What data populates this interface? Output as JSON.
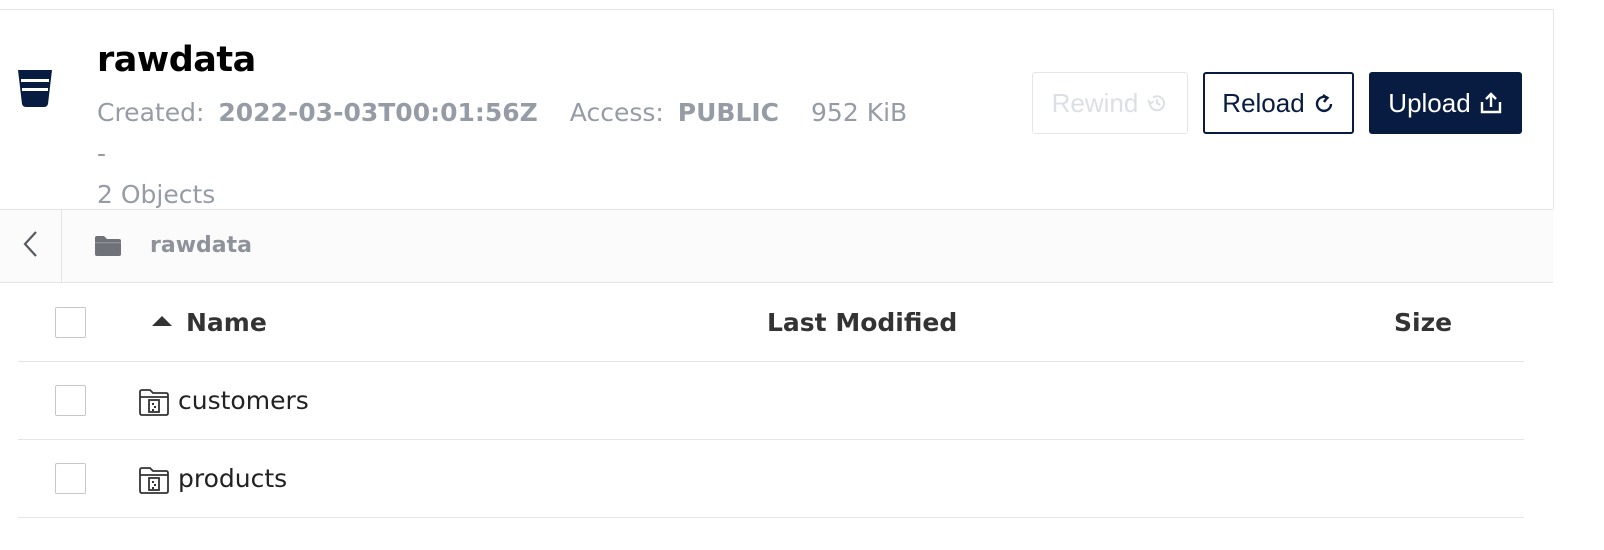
{
  "bucket": {
    "name": "rawdata",
    "created_label": "Created:",
    "created_value": "2022-03-03T00:01:56Z",
    "access_label": "Access:",
    "access_value": "PUBLIC",
    "size_text": "952 KiB -",
    "objects_text": "2 Objects",
    "icon": "bucket-icon"
  },
  "actions": {
    "rewind_label": "Rewind",
    "reload_label": "Reload",
    "upload_label": "Upload"
  },
  "breadcrumb": {
    "path": "rawdata",
    "back_icon": "chevron-left-icon",
    "folder_icon": "folder-icon"
  },
  "table": {
    "columns": [
      "Name",
      "Last Modified",
      "Size"
    ],
    "sort_column": "Name",
    "sort_direction": "ascending",
    "rows": [
      {
        "name": "customers",
        "last_modified": "",
        "size": ""
      },
      {
        "name": "products",
        "last_modified": "",
        "size": ""
      }
    ]
  },
  "colors": {
    "primary": "#081c42",
    "muted_text": "#969ca6",
    "disabled": "#dcdfe4"
  }
}
